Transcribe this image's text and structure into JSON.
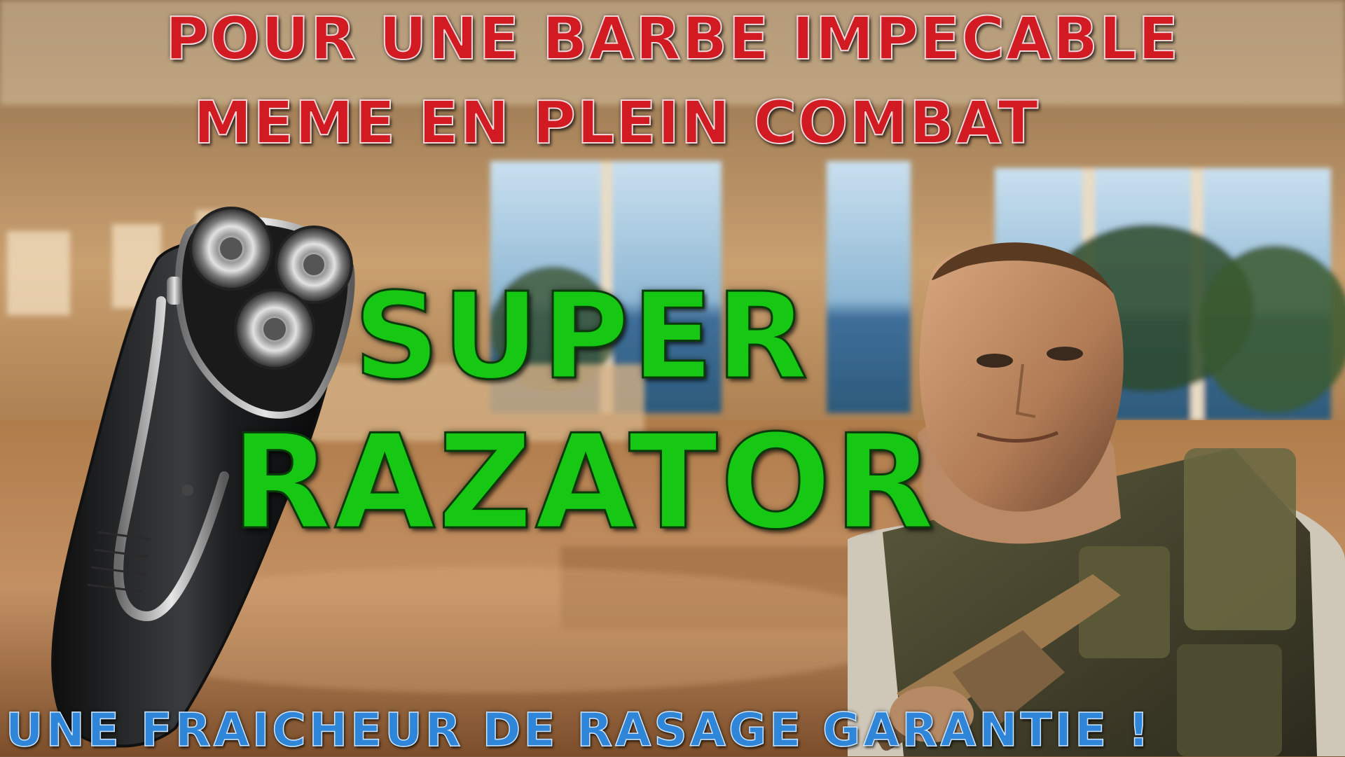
{
  "headline": {
    "line1": "POUR UNE BARBE IMPECABLE",
    "line2": "MEME EN PLEIN COMBAT"
  },
  "product": {
    "name_line1": "SUPER",
    "name_line2": "RAZATOR"
  },
  "tagline": "UNE FRAICHEUR DE RASAGE GARANTIE !",
  "colors": {
    "headline": "#d11a22",
    "product_name": "#16c814",
    "tagline": "#2f86d8"
  }
}
